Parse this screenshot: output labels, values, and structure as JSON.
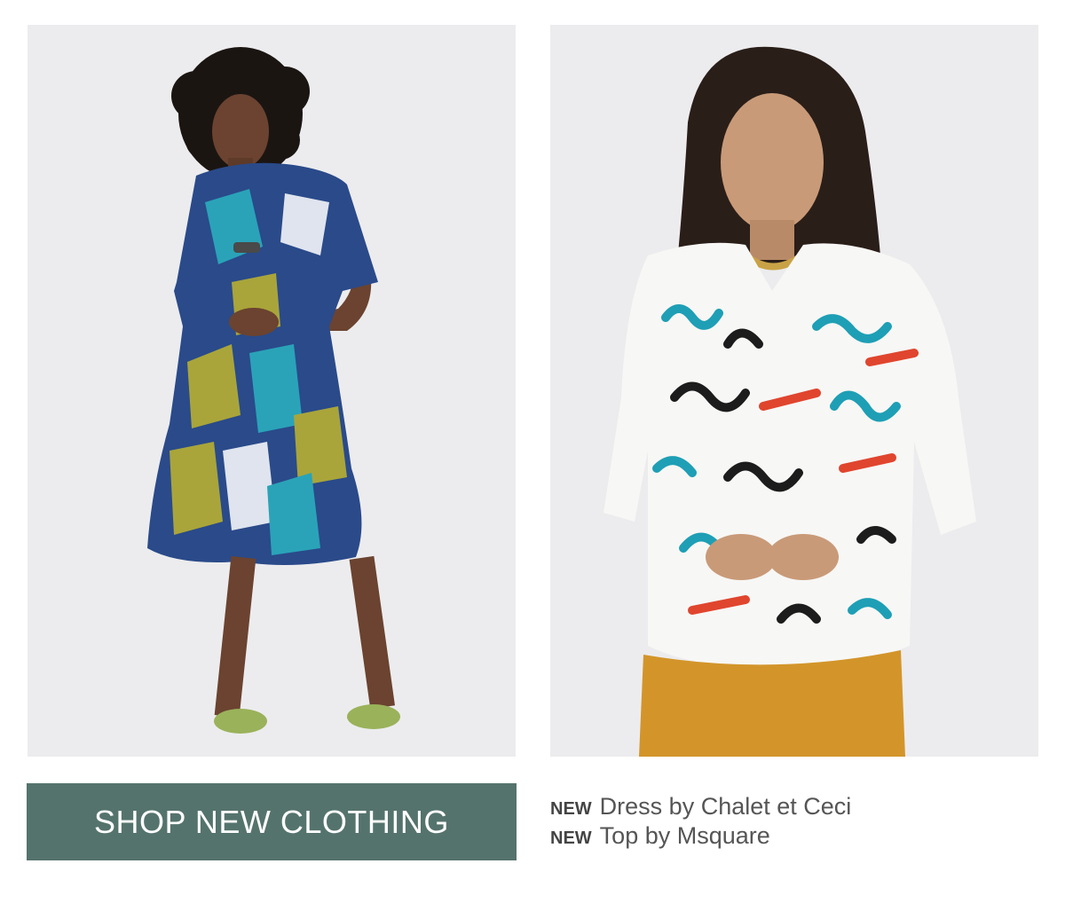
{
  "products": [
    {
      "image_alt": "Woman wearing a blue, teal and olive printed short-sleeve dress with green flats",
      "colors": {
        "background": "#ececee",
        "dress_blue": "#2a4a8a",
        "dress_teal": "#2aa3b8",
        "dress_olive": "#a9a53a",
        "shoes": "#9ab25a",
        "skin": "#6b4330",
        "hair": "#1b1512"
      }
    },
    {
      "image_alt": "Woman wearing a white long-sleeve top with teal, black and red brushstroke print and mustard pants",
      "colors": {
        "background": "#ececee",
        "top": "#f7f7f5",
        "brush_teal": "#1e9fb5",
        "brush_black": "#1c1c1c",
        "brush_red": "#e0452e",
        "pants": "#d3952a",
        "skin": "#c99a78",
        "hair": "#2a1e18"
      }
    }
  ],
  "cta": {
    "label": "SHOP NEW CLOTHING",
    "color": "#55736d"
  },
  "captions": [
    {
      "tag": "NEW",
      "text": "Dress by Chalet et Ceci"
    },
    {
      "tag": "NEW",
      "text": "Top by Msquare"
    }
  ]
}
